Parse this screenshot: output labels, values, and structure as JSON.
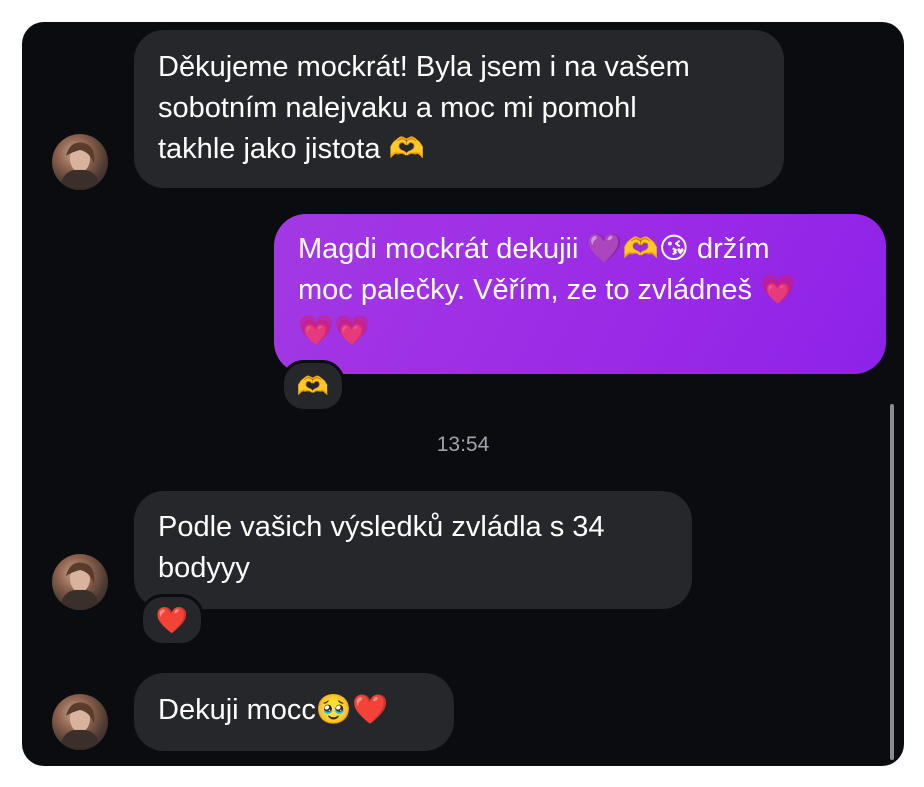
{
  "messages": [
    {
      "text": "Děkujeme mockrát! Byla jsem i na vašem\nsobotním nalejvaku a moc mi pomohl\ntakhle jako jistota 🫶"
    },
    {
      "text": "Magdi mockrát dekujii 💜🫶😘 držím\nmoc palečky. Věřím, ze to zvládneš 💗\n💗💗",
      "reaction": "🫶"
    },
    {
      "text": "Podle vašich výsledků zvládla s 34\nbodyyy",
      "reaction": "❤️"
    },
    {
      "text": "Dekuji mocc🥹❤️"
    }
  ],
  "timestamp": "13:54"
}
